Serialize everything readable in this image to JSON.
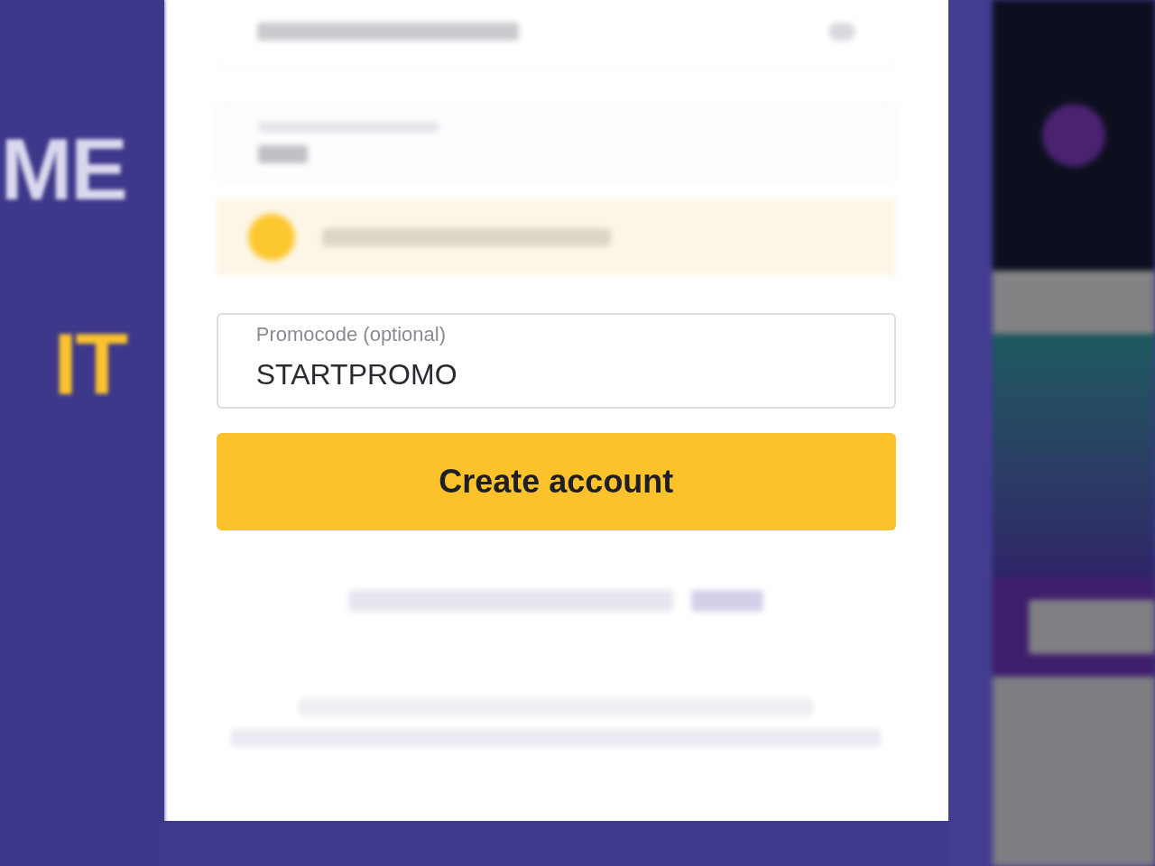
{
  "banner": {
    "lines": [
      {
        "text": "ME",
        "kind": "plain"
      },
      {
        "text": "IT",
        "kind": "accent"
      }
    ]
  },
  "promocode": {
    "label": "Promocode (optional)",
    "value": "STARTPROMO"
  },
  "submit_button": {
    "label": "Create account"
  }
}
